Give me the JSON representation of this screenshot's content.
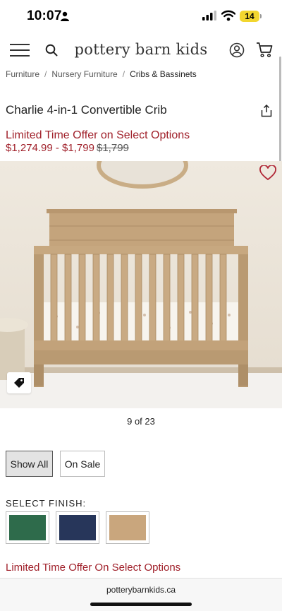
{
  "status_bar": {
    "time": "10:07",
    "battery": "14"
  },
  "header": {
    "logo": "pottery barn kids"
  },
  "breadcrumb": {
    "items": [
      "Furniture",
      "Nursery Furniture",
      "Cribs & Bassinets"
    ]
  },
  "product": {
    "title": "Charlie 4-in-1 Convertible Crib",
    "offer": "Limited Time Offer on Select Options",
    "price_range": "$1,274.99 - $1,799",
    "price_original": "$1,799"
  },
  "gallery": {
    "counter": "9 of 23"
  },
  "filters": {
    "show_all": "Show All",
    "on_sale": "On Sale"
  },
  "finish": {
    "label": "SELECT FINISH:",
    "swatches": [
      {
        "name": "green",
        "color": "#2e6b4b"
      },
      {
        "name": "navy",
        "color": "#27365a"
      },
      {
        "name": "natural-oak",
        "color": "#c9a67d"
      }
    ]
  },
  "offer_bottom": "Limited Time Offer On Select Options",
  "browser": {
    "url": "potterybarnkids.ca"
  },
  "colors": {
    "accent_red": "#a0202a"
  }
}
